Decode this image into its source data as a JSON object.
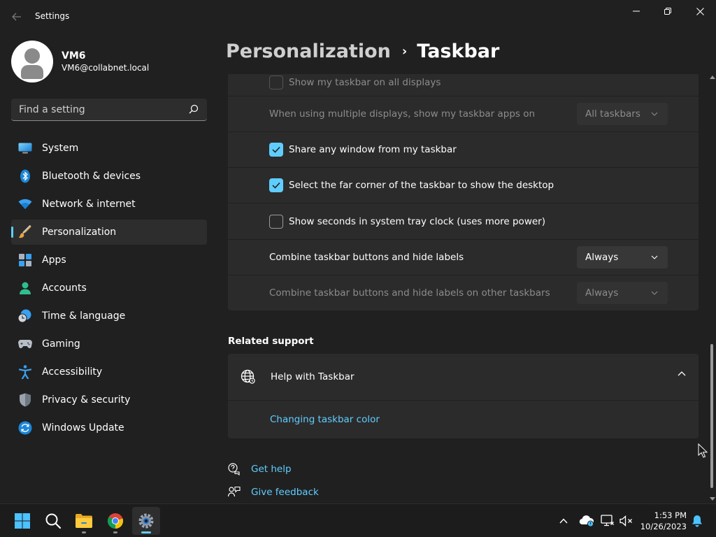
{
  "window": {
    "title": "Settings"
  },
  "profile": {
    "name": "VM6",
    "email": "VM6@collabnet.local"
  },
  "search": {
    "placeholder": "Find a setting"
  },
  "nav": {
    "items": [
      {
        "label": "System",
        "icon": "system-icon"
      },
      {
        "label": "Bluetooth & devices",
        "icon": "bluetooth-icon"
      },
      {
        "label": "Network & internet",
        "icon": "wifi-icon"
      },
      {
        "label": "Personalization",
        "icon": "brush-icon",
        "active": true
      },
      {
        "label": "Apps",
        "icon": "apps-icon"
      },
      {
        "label": "Accounts",
        "icon": "person-icon"
      },
      {
        "label": "Time & language",
        "icon": "clock-globe-icon"
      },
      {
        "label": "Gaming",
        "icon": "gamepad-icon"
      },
      {
        "label": "Accessibility",
        "icon": "accessibility-icon"
      },
      {
        "label": "Privacy & security",
        "icon": "shield-icon"
      },
      {
        "label": "Windows Update",
        "icon": "update-icon"
      }
    ]
  },
  "breadcrumb": {
    "parent": "Personalization",
    "separator": "›",
    "current": "Taskbar"
  },
  "settings": {
    "show_all_displays": {
      "label": "Show my taskbar on all displays",
      "checked": false,
      "disabled": true
    },
    "multi_display_apps": {
      "label": "When using multiple displays, show my taskbar apps on",
      "value": "All taskbars",
      "disabled": true
    },
    "share_window": {
      "label": "Share any window from my taskbar",
      "checked": true
    },
    "far_corner": {
      "label": "Select the far corner of the taskbar to show the desktop",
      "checked": true
    },
    "show_seconds": {
      "label": "Show seconds in system tray clock (uses more power)",
      "checked": false
    },
    "combine_buttons": {
      "label": "Combine taskbar buttons and hide labels",
      "value": "Always"
    },
    "combine_other": {
      "label": "Combine taskbar buttons and hide labels on other taskbars",
      "value": "Always",
      "disabled": true
    }
  },
  "related_support": {
    "title": "Related support",
    "help_title": "Help with Taskbar",
    "link": "Changing taskbar color"
  },
  "footer": {
    "get_help": "Get help",
    "give_feedback": "Give feedback"
  },
  "taskbar": {
    "apps": [
      "start-icon",
      "search-icon",
      "file-explorer-icon",
      "chrome-icon",
      "settings-icon"
    ],
    "time": "1:53 PM",
    "date": "10/26/2023"
  },
  "colors": {
    "accent": "#60cdff",
    "background": "#202020",
    "card": "#2b2b2b"
  }
}
